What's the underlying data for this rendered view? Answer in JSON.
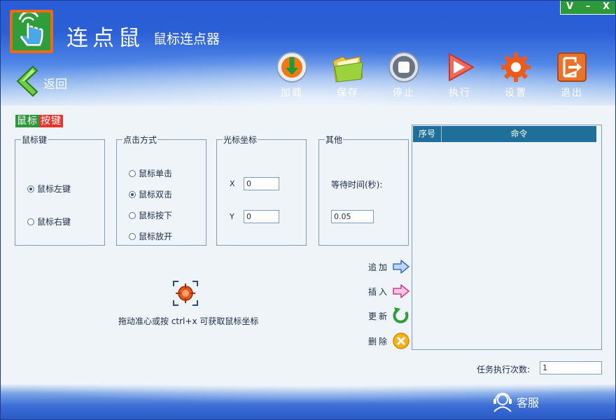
{
  "app": {
    "name": "连点鼠",
    "subtitle": "鼠标连点器",
    "back_label": "返回"
  },
  "window_controls": {
    "dropdown": "V",
    "minimize": "–",
    "close": "X"
  },
  "toolbar": [
    {
      "label": "加载",
      "icon": "load-icon"
    },
    {
      "label": "保存",
      "icon": "save-folder-icon"
    },
    {
      "label": "停止",
      "icon": "stop-icon"
    },
    {
      "label": "执行",
      "icon": "play-icon"
    },
    {
      "label": "设置",
      "icon": "gear-icon"
    },
    {
      "label": "退出",
      "icon": "exit-icon"
    }
  ],
  "tabs": {
    "mouse": "鼠标",
    "key": "按键"
  },
  "mouse_button": {
    "title": "鼠标键",
    "left": "鼠标左键",
    "right": "鼠标右键",
    "selected": "left"
  },
  "click_mode": {
    "title": "点击方式",
    "options": [
      "鼠标单击",
      "鼠标双击",
      "鼠标按下",
      "鼠标放开"
    ],
    "selected": 1
  },
  "cursor_coords": {
    "title": "光标坐标",
    "x_label": "X",
    "x_value": "0",
    "y_label": "Y",
    "y_value": "0"
  },
  "other": {
    "title": "其他",
    "wait_label": "等待时间(秒):",
    "wait_value": "0.05"
  },
  "command_list": {
    "col_index": "序号",
    "col_command": "命令",
    "rows": []
  },
  "actions": {
    "add": "追加",
    "insert": "插入",
    "update": "更新",
    "delete": "删除"
  },
  "hint": "拖动准心或按 ctrl+x 可获取鼠标坐标",
  "task_count": {
    "label": "任务执行次数:",
    "value": "1"
  },
  "footer": {
    "service_label": "客服"
  },
  "colors": {
    "header_blue": "#2b5fd6",
    "green": "#2d9a3a",
    "red": "#e8362d",
    "list_header": "#1e6f99",
    "orange": "#ee6a12"
  }
}
